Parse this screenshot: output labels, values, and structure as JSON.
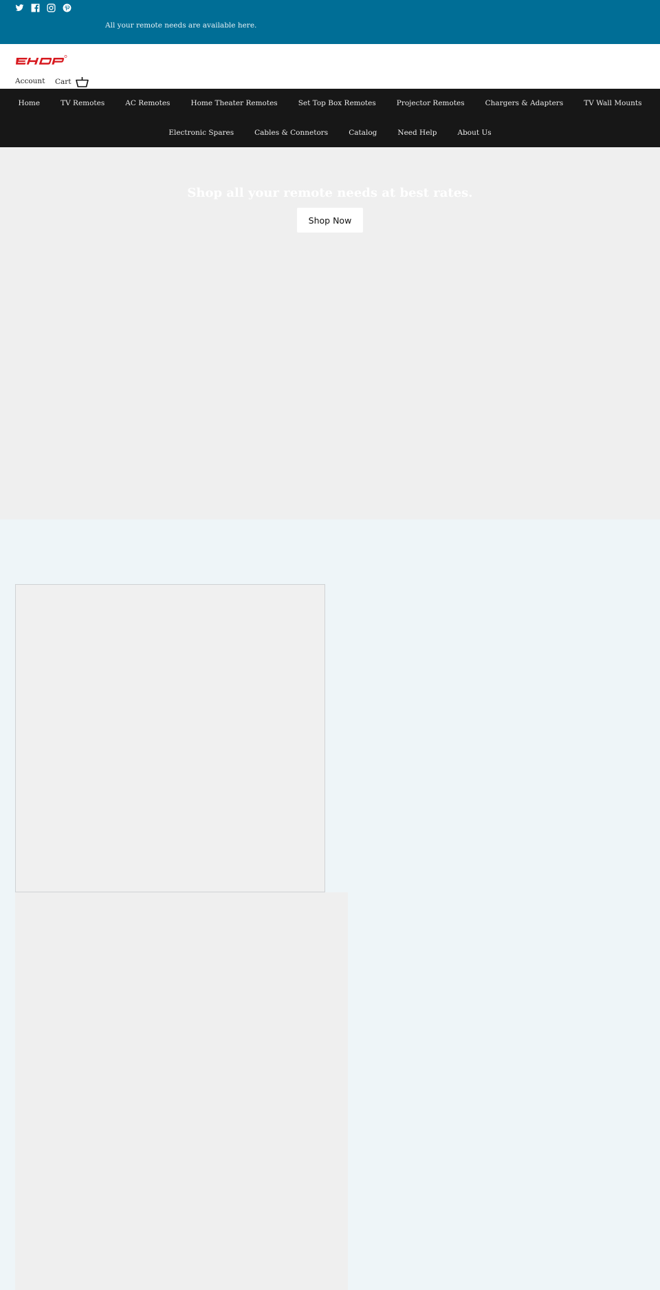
{
  "topbar": {
    "bg_color": "#006e96",
    "social_icons": [
      {
        "name": "twitter-icon",
        "label": "Twitter"
      },
      {
        "name": "facebook-icon",
        "label": "Facebook"
      },
      {
        "name": "instagram-icon",
        "label": "Instagram"
      },
      {
        "name": "pinterest-icon",
        "label": "Pinterest"
      }
    ],
    "announcement": "All your remote needs are available here."
  },
  "header": {
    "logo_text": "EHOP",
    "logo_color": "#d7191f",
    "account_label": "Account",
    "cart_label": "Cart",
    "cart_icon": "basket-icon"
  },
  "nav": {
    "row1": [
      "Home",
      "TV Remotes",
      "AC Remotes",
      "Home Theater Remotes",
      "Set Top Box Remotes",
      "Projector Remotes",
      "Chargers & Adapters",
      "TV Wall Mounts"
    ],
    "row2": [
      "Electronic Spares",
      "Cables & Connetors",
      "Catalog",
      "Need Help",
      "About Us"
    ]
  },
  "hero": {
    "title": "Shop all your remote needs at best rates.",
    "button_label": "Shop Now"
  }
}
